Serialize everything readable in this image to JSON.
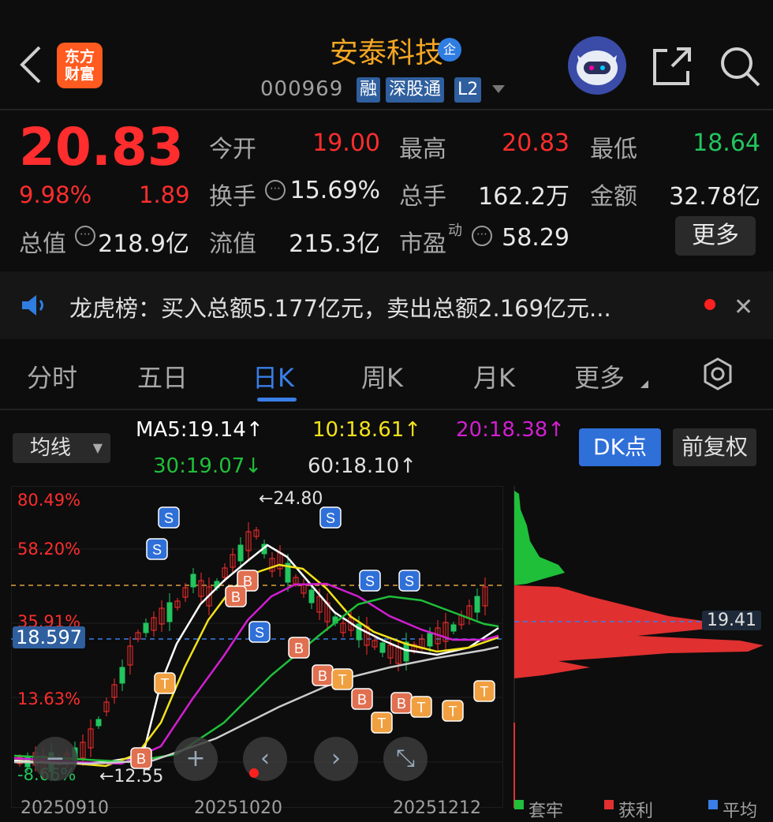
{
  "header": {
    "logo_line1": "东方",
    "logo_line2": "财富",
    "stock_name": "安泰科技",
    "badge": "企",
    "code": "000969",
    "tags": [
      "融",
      "深股通",
      "L2"
    ]
  },
  "quote": {
    "price": "20.83",
    "change_pct": "9.98%",
    "change": "1.89",
    "open_label": "今开",
    "open": "19.00",
    "high_label": "最高",
    "high": "20.83",
    "low_label": "最低",
    "low": "18.64",
    "turnover_label": "换手",
    "turnover": "15.69%",
    "volume_label": "总手",
    "volume": "162.2万",
    "amount_label": "金额",
    "amount": "32.78亿",
    "total_value_label": "总值",
    "total_value": "218.9亿",
    "float_value_label": "流值",
    "float_value": "215.3亿",
    "pe_label": "市盈",
    "pe_sup": "动",
    "pe": "58.29",
    "more": "更多"
  },
  "news": {
    "text": "龙虎榜：买入总额5.177亿元，卖出总额2.169亿元..."
  },
  "tabs": [
    "分时",
    "五日",
    "日K",
    "周K",
    "月K",
    "更多"
  ],
  "ma_bar": {
    "select": "均线",
    "ma5": "MA5:19.14↑",
    "ma10": "10:18.61↑",
    "ma20": "20:18.38↑",
    "ma30": "30:19.07↓",
    "ma60": "60:18.10↑",
    "dk_button": "DK点",
    "fq_button": "前复权"
  },
  "chart": {
    "y_labels": [
      "80.49%",
      "58.20%",
      "35.91%",
      "13.63%",
      "-8.66%"
    ],
    "high_marker": "←24.80",
    "low_marker": "←12.55",
    "cursor_price": "18.597",
    "profile_price": "19.41",
    "x_labels": [
      "20250910",
      "20251020",
      "20251212"
    ],
    "legend": [
      "套牢",
      "获利",
      "平均"
    ]
  },
  "colors": {
    "up": "#ff2d2d",
    "down": "#22c55e",
    "accent": "#2f6fd8",
    "ma5": "#ffffff",
    "ma10": "#f2e21a",
    "ma20": "#d11fd1",
    "ma30": "#1fbf3a",
    "ma60": "#cccccc"
  }
}
